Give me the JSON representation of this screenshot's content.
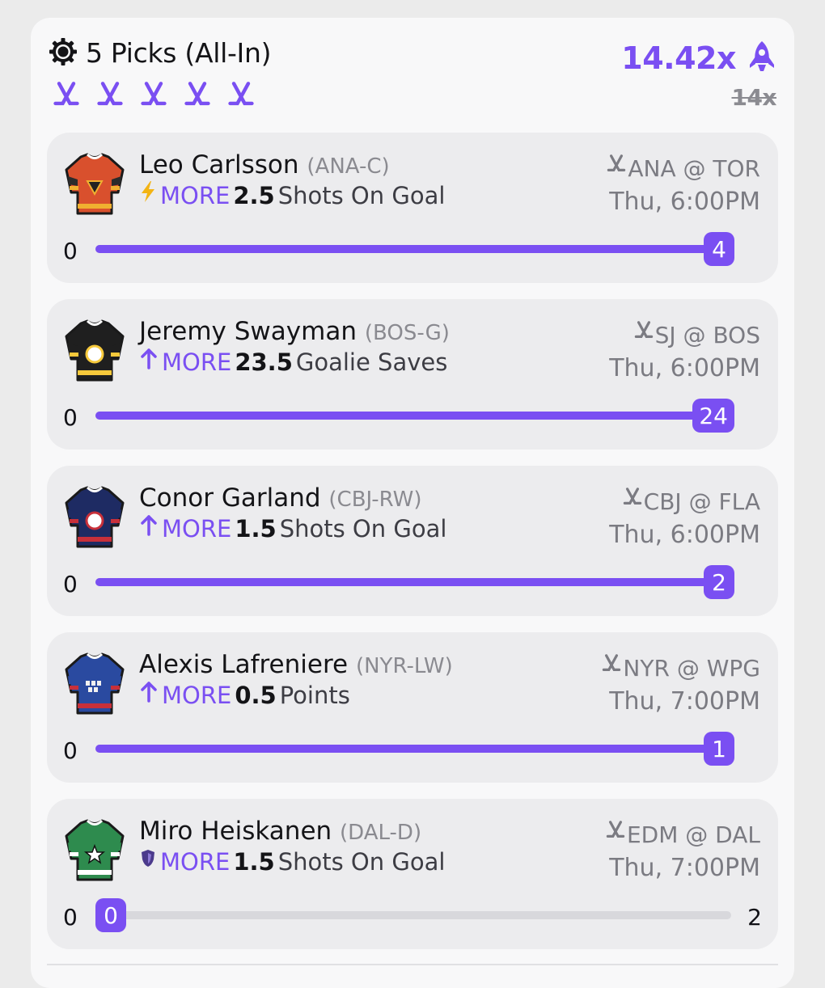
{
  "header": {
    "title": "5 Picks (All-In)",
    "multiplier": "14.42x",
    "old_multiplier": "14x",
    "title_icon": "gear-icon",
    "boost_icon": "rocket-icon",
    "sport_icon": "hockey-sticks-icon",
    "accent_color": "#7a4ff2"
  },
  "picks": [
    {
      "name": "Leo Carlsson",
      "pos": "(ANA-C)",
      "badge_icon": "lightning-icon",
      "direction": "MORE",
      "line": "2.5",
      "stat": "Shots On Goal",
      "matchup": "ANA @ TOR",
      "time": "Thu, 6:00PM",
      "progress_start": "0",
      "progress_value": "4",
      "progress_end": "",
      "progress_fraction": 1,
      "jersey": {
        "body": "#d9502d",
        "arm": "#2b2b2b",
        "stripe": "#f0b030",
        "emblem": "triangle"
      }
    },
    {
      "name": "Jeremy Swayman",
      "pos": "(BOS-G)",
      "badge_icon": "arrow-up-icon",
      "direction": "MORE",
      "line": "23.5",
      "stat": "Goalie Saves",
      "matchup": "SJ @ BOS",
      "time": "Thu, 6:00PM",
      "progress_start": "0",
      "progress_value": "24",
      "progress_end": "",
      "progress_fraction": 1,
      "jersey": {
        "body": "#1f1f1f",
        "arm": "#1f1f1f",
        "stripe": "#f6c93b",
        "emblem": "circle"
      }
    },
    {
      "name": "Conor Garland",
      "pos": "(CBJ-RW)",
      "badge_icon": "arrow-up-icon",
      "direction": "MORE",
      "line": "1.5",
      "stat": "Shots On Goal",
      "matchup": "CBJ @ FLA",
      "time": "Thu, 6:00PM",
      "progress_start": "0",
      "progress_value": "2",
      "progress_end": "",
      "progress_fraction": 1,
      "jersey": {
        "body": "#1e2b63",
        "arm": "#1e2b63",
        "stripe": "#c8303a",
        "emblem": "circle"
      }
    },
    {
      "name": "Alexis Lafreniere",
      "pos": "(NYR-LW)",
      "badge_icon": "arrow-up-icon",
      "direction": "MORE",
      "line": "0.5",
      "stat": "Points",
      "matchup": "NYR @ WPG",
      "time": "Thu, 7:00PM",
      "progress_start": "0",
      "progress_value": "1",
      "progress_end": "",
      "progress_fraction": 1,
      "jersey": {
        "body": "#2a4aa0",
        "arm": "#2a4aa0",
        "stripe": "#c8303a",
        "emblem": "text"
      }
    },
    {
      "name": "Miro Heiskanen",
      "pos": "(DAL-D)",
      "badge_icon": "shield-icon",
      "direction": "MORE",
      "line": "1.5",
      "stat": "Shots On Goal",
      "matchup": "EDM @ DAL",
      "time": "Thu, 7:00PM",
      "progress_start": "0",
      "progress_value": "0",
      "progress_end": "2",
      "progress_fraction": 0,
      "jersey": {
        "body": "#2e8b4e",
        "arm": "#2e8b4e",
        "stripe": "#ffffff",
        "emblem": "star"
      }
    }
  ]
}
